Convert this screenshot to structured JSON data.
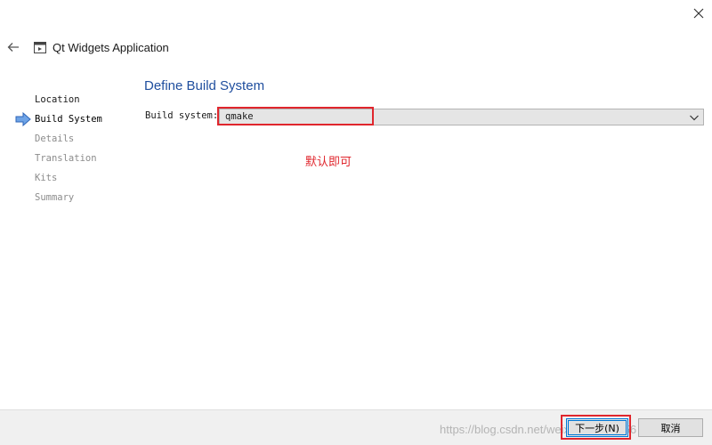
{
  "window": {
    "title": "Qt Widgets Application",
    "close_icon": "close-icon",
    "back_icon": "back-arrow-icon",
    "app_icon": "qt-application-icon"
  },
  "steps": [
    {
      "label": "Location",
      "state": "done"
    },
    {
      "label": "Build System",
      "state": "current"
    },
    {
      "label": "Details",
      "state": "pending"
    },
    {
      "label": "Translation",
      "state": "pending"
    },
    {
      "label": "Kits",
      "state": "pending"
    },
    {
      "label": "Summary",
      "state": "pending"
    }
  ],
  "page": {
    "heading": "Define Build System",
    "build_system_label": "Build system:",
    "build_system_value": "qmake",
    "annotation": "默认即可"
  },
  "footer": {
    "next_label": "下一步(N)",
    "cancel_label": "取消",
    "watermark": "https://blog.csdn.net/weixin_40495056"
  },
  "colors": {
    "heading": "#1f4e9e",
    "annotation_red": "#e0262d",
    "focus_blue": "#0078d7",
    "step_arrow": "#3a7bd5"
  }
}
